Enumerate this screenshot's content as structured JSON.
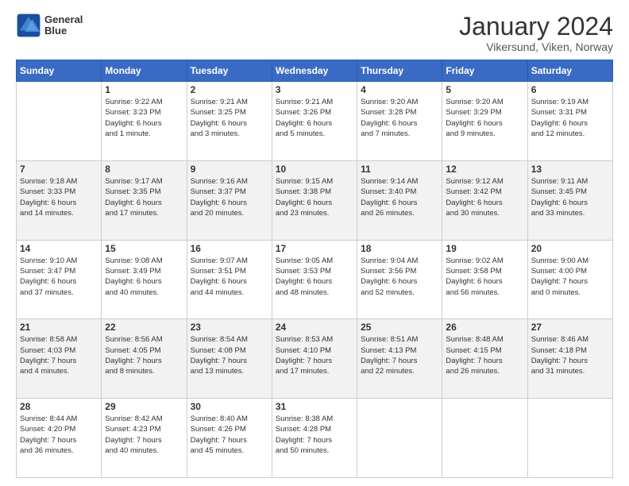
{
  "logo": {
    "line1": "General",
    "line2": "Blue"
  },
  "header": {
    "month": "January 2024",
    "location": "Vikersund, Viken, Norway"
  },
  "columns": [
    "Sunday",
    "Monday",
    "Tuesday",
    "Wednesday",
    "Thursday",
    "Friday",
    "Saturday"
  ],
  "weeks": [
    [
      {
        "day": "",
        "info": ""
      },
      {
        "day": "1",
        "info": "Sunrise: 9:22 AM\nSunset: 3:23 PM\nDaylight: 6 hours\nand 1 minute."
      },
      {
        "day": "2",
        "info": "Sunrise: 9:21 AM\nSunset: 3:25 PM\nDaylight: 6 hours\nand 3 minutes."
      },
      {
        "day": "3",
        "info": "Sunrise: 9:21 AM\nSunset: 3:26 PM\nDaylight: 6 hours\nand 5 minutes."
      },
      {
        "day": "4",
        "info": "Sunrise: 9:20 AM\nSunset: 3:28 PM\nDaylight: 6 hours\nand 7 minutes."
      },
      {
        "day": "5",
        "info": "Sunrise: 9:20 AM\nSunset: 3:29 PM\nDaylight: 6 hours\nand 9 minutes."
      },
      {
        "day": "6",
        "info": "Sunrise: 9:19 AM\nSunset: 3:31 PM\nDaylight: 6 hours\nand 12 minutes."
      }
    ],
    [
      {
        "day": "7",
        "info": "Sunrise: 9:18 AM\nSunset: 3:33 PM\nDaylight: 6 hours\nand 14 minutes."
      },
      {
        "day": "8",
        "info": "Sunrise: 9:17 AM\nSunset: 3:35 PM\nDaylight: 6 hours\nand 17 minutes."
      },
      {
        "day": "9",
        "info": "Sunrise: 9:16 AM\nSunset: 3:37 PM\nDaylight: 6 hours\nand 20 minutes."
      },
      {
        "day": "10",
        "info": "Sunrise: 9:15 AM\nSunset: 3:38 PM\nDaylight: 6 hours\nand 23 minutes."
      },
      {
        "day": "11",
        "info": "Sunrise: 9:14 AM\nSunset: 3:40 PM\nDaylight: 6 hours\nand 26 minutes."
      },
      {
        "day": "12",
        "info": "Sunrise: 9:12 AM\nSunset: 3:42 PM\nDaylight: 6 hours\nand 30 minutes."
      },
      {
        "day": "13",
        "info": "Sunrise: 9:11 AM\nSunset: 3:45 PM\nDaylight: 6 hours\nand 33 minutes."
      }
    ],
    [
      {
        "day": "14",
        "info": "Sunrise: 9:10 AM\nSunset: 3:47 PM\nDaylight: 6 hours\nand 37 minutes."
      },
      {
        "day": "15",
        "info": "Sunrise: 9:08 AM\nSunset: 3:49 PM\nDaylight: 6 hours\nand 40 minutes."
      },
      {
        "day": "16",
        "info": "Sunrise: 9:07 AM\nSunset: 3:51 PM\nDaylight: 6 hours\nand 44 minutes."
      },
      {
        "day": "17",
        "info": "Sunrise: 9:05 AM\nSunset: 3:53 PM\nDaylight: 6 hours\nand 48 minutes."
      },
      {
        "day": "18",
        "info": "Sunrise: 9:04 AM\nSunset: 3:56 PM\nDaylight: 6 hours\nand 52 minutes."
      },
      {
        "day": "19",
        "info": "Sunrise: 9:02 AM\nSunset: 3:58 PM\nDaylight: 6 hours\nand 56 minutes."
      },
      {
        "day": "20",
        "info": "Sunrise: 9:00 AM\nSunset: 4:00 PM\nDaylight: 7 hours\nand 0 minutes."
      }
    ],
    [
      {
        "day": "21",
        "info": "Sunrise: 8:58 AM\nSunset: 4:03 PM\nDaylight: 7 hours\nand 4 minutes."
      },
      {
        "day": "22",
        "info": "Sunrise: 8:56 AM\nSunset: 4:05 PM\nDaylight: 7 hours\nand 8 minutes."
      },
      {
        "day": "23",
        "info": "Sunrise: 8:54 AM\nSunset: 4:08 PM\nDaylight: 7 hours\nand 13 minutes."
      },
      {
        "day": "24",
        "info": "Sunrise: 8:53 AM\nSunset: 4:10 PM\nDaylight: 7 hours\nand 17 minutes."
      },
      {
        "day": "25",
        "info": "Sunrise: 8:51 AM\nSunset: 4:13 PM\nDaylight: 7 hours\nand 22 minutes."
      },
      {
        "day": "26",
        "info": "Sunrise: 8:48 AM\nSunset: 4:15 PM\nDaylight: 7 hours\nand 26 minutes."
      },
      {
        "day": "27",
        "info": "Sunrise: 8:46 AM\nSunset: 4:18 PM\nDaylight: 7 hours\nand 31 minutes."
      }
    ],
    [
      {
        "day": "28",
        "info": "Sunrise: 8:44 AM\nSunset: 4:20 PM\nDaylight: 7 hours\nand 36 minutes."
      },
      {
        "day": "29",
        "info": "Sunrise: 8:42 AM\nSunset: 4:23 PM\nDaylight: 7 hours\nand 40 minutes."
      },
      {
        "day": "30",
        "info": "Sunrise: 8:40 AM\nSunset: 4:26 PM\nDaylight: 7 hours\nand 45 minutes."
      },
      {
        "day": "31",
        "info": "Sunrise: 8:38 AM\nSunset: 4:28 PM\nDaylight: 7 hours\nand 50 minutes."
      },
      {
        "day": "",
        "info": ""
      },
      {
        "day": "",
        "info": ""
      },
      {
        "day": "",
        "info": ""
      }
    ]
  ]
}
